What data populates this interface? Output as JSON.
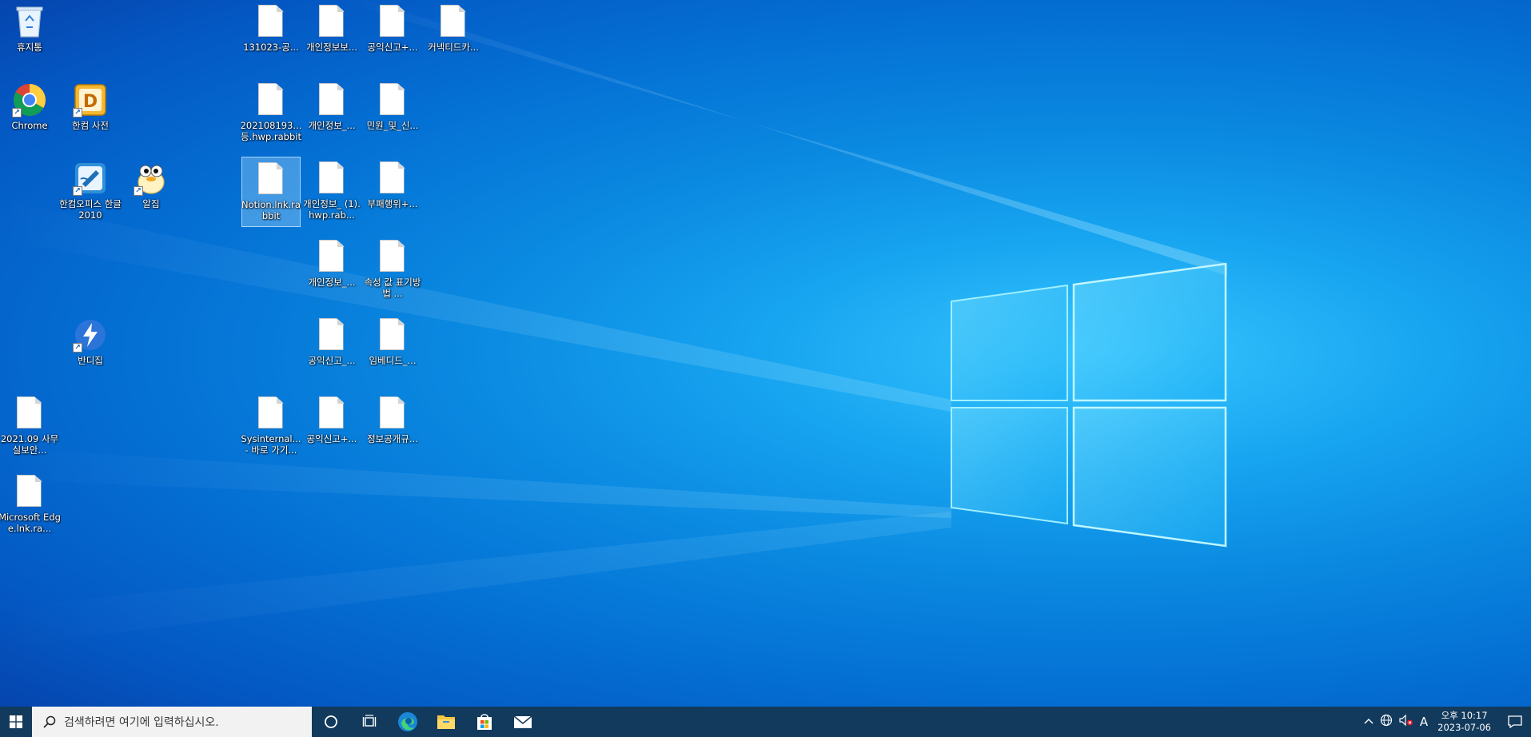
{
  "desktop": {
    "icons": [
      {
        "label": "휴지통",
        "type": "recycle",
        "shortcut": false
      },
      {
        "label": "Chrome",
        "type": "chrome",
        "shortcut": true
      },
      {
        "label": "한컴 사전",
        "type": "hancom-dict",
        "shortcut": true
      },
      {
        "label": "한컴오피스 한글 2010",
        "type": "hwp",
        "shortcut": true
      },
      {
        "label": "알집",
        "type": "alzip",
        "shortcut": true
      },
      {
        "label": "반디집",
        "type": "bandizip",
        "shortcut": true
      },
      {
        "label": "2021.09 사무실보안...",
        "type": "file",
        "shortcut": false
      },
      {
        "label": "Microsoft Edge.lnk.ra...",
        "type": "file",
        "shortcut": false
      },
      {
        "label": "131023-공...",
        "type": "file",
        "shortcut": false
      },
      {
        "label": "개인정보보...",
        "type": "file",
        "shortcut": false
      },
      {
        "label": "공익신고+...",
        "type": "file",
        "shortcut": false
      },
      {
        "label": "커넥티드카...",
        "type": "file",
        "shortcut": false
      },
      {
        "label": "202108193... 등.hwp.rabbit",
        "type": "file",
        "shortcut": false
      },
      {
        "label": "개인정보_...",
        "type": "file",
        "shortcut": false
      },
      {
        "label": "민원_및_신...",
        "type": "file",
        "shortcut": false
      },
      {
        "label": "Notion.lnk.rabbit",
        "type": "file",
        "shortcut": false,
        "selected": true
      },
      {
        "label": "개인정보_ (1).hwp.rab...",
        "type": "file",
        "shortcut": false
      },
      {
        "label": "부패행위+...",
        "type": "file",
        "shortcut": false
      },
      {
        "label": "개인정보_...",
        "type": "file",
        "shortcut": false
      },
      {
        "label": "속성 값 표기방법 ...",
        "type": "file",
        "shortcut": false
      },
      {
        "label": "공익신고_...",
        "type": "file",
        "shortcut": false
      },
      {
        "label": "임베디드_...",
        "type": "file",
        "shortcut": false
      },
      {
        "label": "Sysinternal... - 바로 가기...",
        "type": "file",
        "shortcut": false
      },
      {
        "label": "공익신고+...",
        "type": "file",
        "shortcut": false
      },
      {
        "label": "정보공개규...",
        "type": "file",
        "shortcut": false
      }
    ]
  },
  "taskbar": {
    "search_placeholder": "검색하려면 여기에 입력하십시오.",
    "apps": [
      "cortana-icon",
      "task-view-icon",
      "edge-icon",
      "file-explorer-icon",
      "store-icon",
      "mail-icon"
    ],
    "tray": {
      "ime": "A",
      "time": "오후 10:17",
      "date": "2023-07-06"
    }
  },
  "colors": {
    "wallpaper_center": "#38c6ff",
    "wallpaper_edge": "#063fa8",
    "taskbar": "#123a5c"
  }
}
